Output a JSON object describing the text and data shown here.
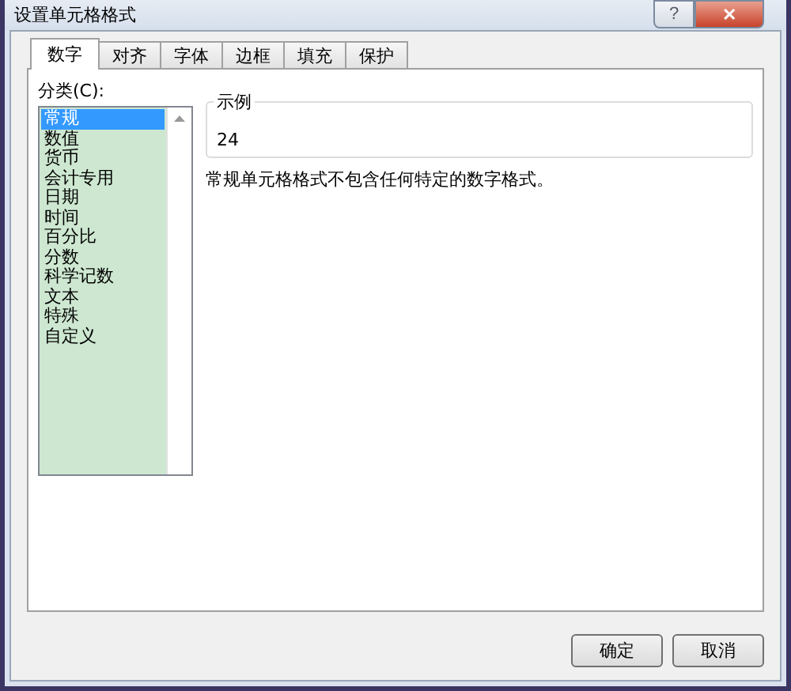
{
  "window": {
    "title": "设置单元格格式",
    "help": "?",
    "close": "✕"
  },
  "tabs": [
    {
      "label": "数字",
      "selected": true
    },
    {
      "label": "对齐",
      "selected": false
    },
    {
      "label": "字体",
      "selected": false
    },
    {
      "label": "边框",
      "selected": false
    },
    {
      "label": "填充",
      "selected": false
    },
    {
      "label": "保护",
      "selected": false
    }
  ],
  "category": {
    "label": "分类(C):",
    "items": [
      {
        "label": "常规",
        "selected": true
      },
      {
        "label": "数值",
        "selected": false
      },
      {
        "label": "货币",
        "selected": false
      },
      {
        "label": "会计专用",
        "selected": false
      },
      {
        "label": "日期",
        "selected": false
      },
      {
        "label": "时间",
        "selected": false
      },
      {
        "label": "百分比",
        "selected": false
      },
      {
        "label": "分数",
        "selected": false
      },
      {
        "label": "科学记数",
        "selected": false
      },
      {
        "label": "文本",
        "selected": false
      },
      {
        "label": "特殊",
        "selected": false
      },
      {
        "label": "自定义",
        "selected": false
      }
    ]
  },
  "sample": {
    "label": "示例",
    "value": "24"
  },
  "description": "常规单元格格式不包含任何特定的数字格式。",
  "buttons": [
    "确定",
    "取消"
  ]
}
